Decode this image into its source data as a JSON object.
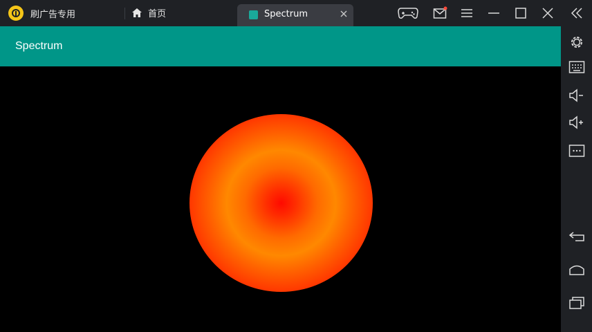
{
  "topbar": {
    "brand_label": "刷广告专用",
    "home_label": "首页",
    "active_tab_label": "Spectrum"
  },
  "app": {
    "title": "Spectrum"
  },
  "colors": {
    "appbar": "#009688",
    "topbar_bg": "#1f2125",
    "active_tab_bg": "#3a3c42",
    "spectrum_center": "#ff0a00",
    "spectrum_ring": "#ff8800",
    "spectrum_edge": "#ff1000"
  },
  "icons": {
    "topbar_right": [
      "gamepad-icon",
      "mail-icon",
      "menu-icon",
      "minimize-icon",
      "maximize-icon",
      "close-icon",
      "collapse-icon"
    ],
    "sidebar": [
      "settings-icon",
      "keyboard-icon",
      "volume-down-icon",
      "volume-up-icon",
      "more-icon",
      "back-icon",
      "home-icon",
      "recents-icon"
    ]
  }
}
